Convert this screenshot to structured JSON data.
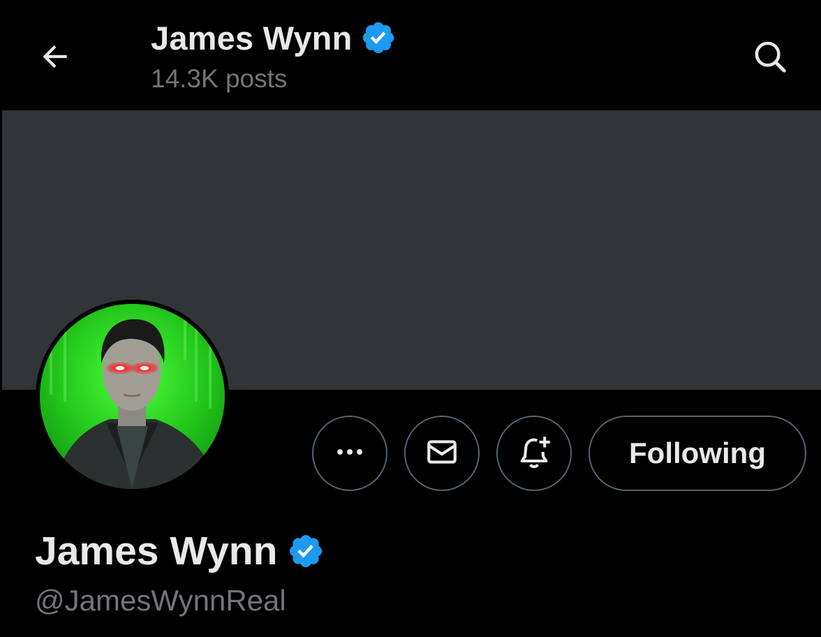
{
  "header": {
    "name": "James Wynn",
    "posts_count": "14.3K posts",
    "back_icon": "arrow-left-icon",
    "search_icon": "search-icon"
  },
  "profile": {
    "name": "James Wynn",
    "handle": "@JamesWynnReal",
    "verified": true,
    "verified_icon": "verified-badge-icon"
  },
  "actions": {
    "more_icon": "ellipsis-icon",
    "message_icon": "mail-icon",
    "notify_icon": "bell-plus-icon",
    "following_label": "Following"
  },
  "colors": {
    "background": "#000000",
    "banner": "#323538",
    "text_primary": "#e7e9ea",
    "text_secondary": "#71767b",
    "button_border": "#536471",
    "verified_blue": "#1d9bf0"
  }
}
